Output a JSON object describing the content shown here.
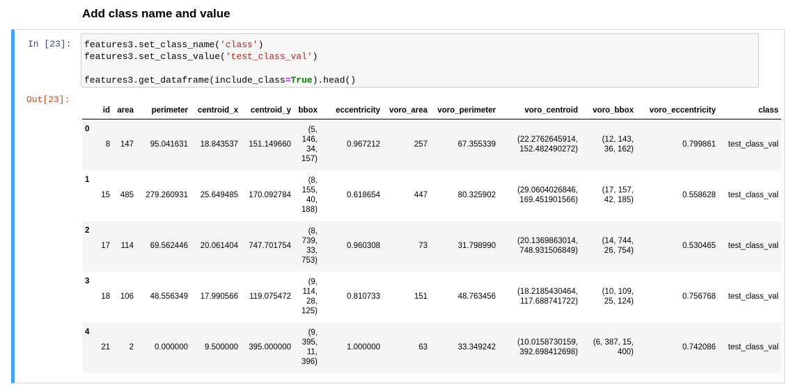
{
  "heading": "Add class name and value",
  "cell": {
    "in_prompt": "In [23]:",
    "out_prompt": "Out[23]:",
    "code": {
      "line1_prefix": "features3.set_class_name(",
      "line1_str": "'class'",
      "line1_suffix": ")",
      "line2_prefix": "features3.set_class_value(",
      "line2_str": "'test_class_val'",
      "line2_suffix": ")",
      "line3_prefix": "features3.get_dataframe(include_class",
      "line3_op": "=",
      "line3_kw": "True",
      "line3_suffix": ").head()"
    }
  },
  "table": {
    "columns": [
      "",
      "id",
      "area",
      "perimeter",
      "centroid_x",
      "centroid_y",
      "bbox",
      "eccentricity",
      "voro_area",
      "voro_perimeter",
      "voro_centroid",
      "voro_bbox",
      "voro_eccentricity",
      "class"
    ],
    "rows": [
      {
        "index": "0",
        "id": "8",
        "area": "147",
        "perimeter": "95.041631",
        "centroid_x": "18.843537",
        "centroid_y": "151.149660",
        "bbox": "(5,\n146,\n34,\n157)",
        "eccentricity": "0.967212",
        "voro_area": "257",
        "voro_perimeter": "67.355339",
        "voro_centroid": "(22.2762645914,\n152.482490272)",
        "voro_bbox": "(12, 143,\n36, 162)",
        "voro_eccentricity": "0.799861",
        "class": "test_class_val"
      },
      {
        "index": "1",
        "id": "15",
        "area": "485",
        "perimeter": "279.260931",
        "centroid_x": "25.649485",
        "centroid_y": "170.092784",
        "bbox": "(8,\n155,\n40,\n188)",
        "eccentricity": "0.618654",
        "voro_area": "447",
        "voro_perimeter": "80.325902",
        "voro_centroid": "(29.0604026846,\n169.451901566)",
        "voro_bbox": "(17, 157,\n42, 185)",
        "voro_eccentricity": "0.558628",
        "class": "test_class_val"
      },
      {
        "index": "2",
        "id": "17",
        "area": "114",
        "perimeter": "69.562446",
        "centroid_x": "20.061404",
        "centroid_y": "747.701754",
        "bbox": "(8,\n739,\n33,\n753)",
        "eccentricity": "0.960308",
        "voro_area": "73",
        "voro_perimeter": "31.798990",
        "voro_centroid": "(20.1369863014,\n748.931506849)",
        "voro_bbox": "(14, 744,\n26, 754)",
        "voro_eccentricity": "0.530465",
        "class": "test_class_val"
      },
      {
        "index": "3",
        "id": "18",
        "area": "106",
        "perimeter": "48.556349",
        "centroid_x": "17.990566",
        "centroid_y": "119.075472",
        "bbox": "(9,\n114,\n28,\n125)",
        "eccentricity": "0.810733",
        "voro_area": "151",
        "voro_perimeter": "48.763456",
        "voro_centroid": "(18.2185430464,\n117.688741722)",
        "voro_bbox": "(10, 109,\n25, 124)",
        "voro_eccentricity": "0.756768",
        "class": "test_class_val"
      },
      {
        "index": "4",
        "id": "21",
        "area": "2",
        "perimeter": "0.000000",
        "centroid_x": "9.500000",
        "centroid_y": "395.000000",
        "bbox": "(9,\n395,\n11,\n396)",
        "eccentricity": "1.000000",
        "voro_area": "63",
        "voro_perimeter": "33.349242",
        "voro_centroid": "(10.0158730159,\n392.698412698)",
        "voro_bbox": "(6, 387, 15,\n400)",
        "voro_eccentricity": "0.742086",
        "class": "test_class_val"
      }
    ]
  },
  "colors": {
    "cell_border_accent": "#42a5f5",
    "in_prompt": "#303f9f",
    "out_prompt": "#d84315",
    "string": "#ba2121",
    "keyword": "#008000",
    "operator": "#aa22ff"
  }
}
